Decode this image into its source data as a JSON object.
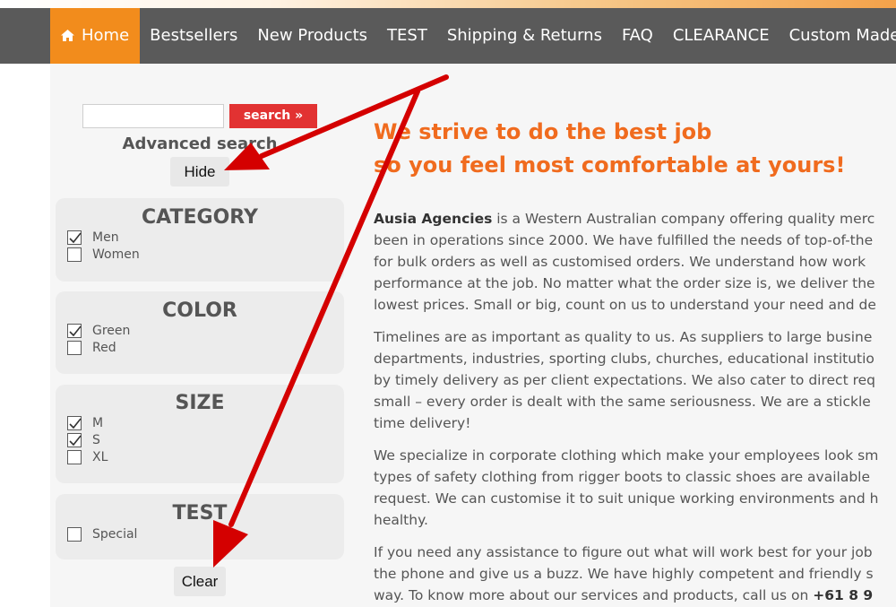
{
  "nav": {
    "items": [
      {
        "label": "Home",
        "icon": "home-icon",
        "active": true
      },
      {
        "label": "Bestsellers"
      },
      {
        "label": "New Products"
      },
      {
        "label": "TEST"
      },
      {
        "label": "Shipping & Returns"
      },
      {
        "label": "FAQ"
      },
      {
        "label": "CLEARANCE"
      },
      {
        "label": "Custom Made"
      }
    ]
  },
  "sidebar": {
    "search": {
      "value": "",
      "button_label": "search »"
    },
    "advanced_search_label": "Advanced search",
    "hide_label": "Hide",
    "clear_label": "Clear",
    "filters": [
      {
        "title": "CATEGORY",
        "options": [
          {
            "label": "Men",
            "checked": true
          },
          {
            "label": "Women",
            "checked": false
          }
        ]
      },
      {
        "title": "COLOR",
        "options": [
          {
            "label": "Green",
            "checked": true
          },
          {
            "label": "Red",
            "checked": false
          }
        ]
      },
      {
        "title": "SIZE",
        "options": [
          {
            "label": "M",
            "checked": true
          },
          {
            "label": "S",
            "checked": true
          },
          {
            "label": "XL",
            "checked": false
          }
        ]
      },
      {
        "title": "TEST",
        "options": [
          {
            "label": "Special",
            "checked": false
          }
        ]
      }
    ]
  },
  "main": {
    "headline": [
      "We strive to do the best job",
      "so you feel most comfortable at yours!"
    ],
    "p1": {
      "company": "Ausia Agencies",
      "first_line_rest": " is a Western Australian company offering quality merc",
      "lines": [
        "been in operations since 2000. We have fulfilled the needs of top-of-the",
        "for bulk orders as well as customised orders. We understand how work",
        "performance at the job. No matter what the order size is, we deliver the",
        "lowest prices. Small or big, count on us to understand your need and de"
      ]
    },
    "p2": [
      "Timelines are as important as quality to us. As suppliers to large busine",
      "departments, industries, sporting clubs, churches, educational institutio",
      "by timely delivery as per client expectations. We also cater to direct req",
      "small – every order is dealt with the same seriousness. We are a stickle",
      "time delivery!"
    ],
    "p3": [
      "We specialize in corporate clothing which make your employees look sm",
      "types of safety clothing from rigger boots to classic shoes are available",
      "request. We can customise it to suit unique working environments and h",
      "healthy."
    ],
    "p4": {
      "lines": [
        "If you need any assistance to figure out what will work best for your job",
        "the phone and give us a buzz. We have highly competent and friendly s"
      ],
      "last_line_prefix": "way. To know more about our services and products, call us on ",
      "phone": "+61 8 9"
    }
  },
  "colors": {
    "nav_bg": "#5a5a5a",
    "nav_active": "#f28c1c",
    "headline": "#f06b1e",
    "search_button": "#e23232",
    "annotation_arrow": "#d40000"
  }
}
